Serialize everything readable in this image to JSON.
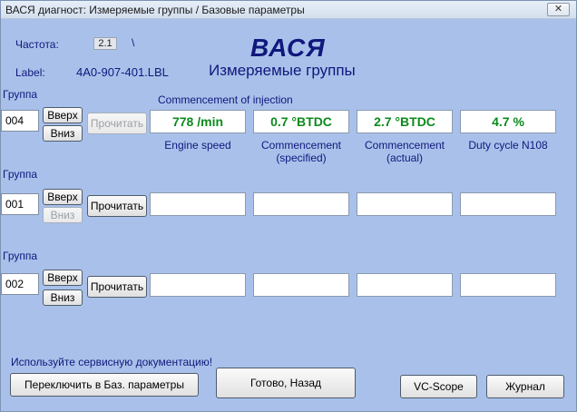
{
  "window": {
    "title": "ВАСЯ диагност: Измеряемые группы / Базовые параметры",
    "close_glyph": "✕"
  },
  "header": {
    "freq_label": "Частота:",
    "freq_value": "2.1",
    "freq_separator": "\\",
    "label_label": "Label:",
    "label_value": "4A0-907-401.LBL",
    "app_name": "ВАСЯ",
    "app_subtitle": "Измеряемые группы"
  },
  "groups": [
    {
      "label": "Группа",
      "number": "004",
      "up_label": "Вверх",
      "down_label": "Вниз",
      "read_label": "Прочитать",
      "header_text": "Commencement of injection",
      "values": [
        "778 /min",
        "0.7 °BTDC",
        "2.7 °BTDC",
        "4.7 %"
      ],
      "captions": [
        [
          "Engine speed"
        ],
        [
          "Commencement",
          "(specified)"
        ],
        [
          "Commencement",
          "(actual)"
        ],
        [
          "Duty cycle N108"
        ]
      ]
    },
    {
      "label": "Группа",
      "number": "001",
      "up_label": "Вверх",
      "down_label": "Вниз",
      "read_label": "Прочитать",
      "values": [
        "",
        "",
        "",
        ""
      ]
    },
    {
      "label": "Группа",
      "number": "002",
      "up_label": "Вверх",
      "down_label": "Вниз",
      "read_label": "Прочитать",
      "values": [
        "",
        "",
        "",
        ""
      ]
    }
  ],
  "footer": {
    "hint": "Используйте сервисную документацию!",
    "switch_label": "Переключить в Баз. параметры",
    "done_label": "Готово, Назад",
    "vcscope_label": "VC-Scope",
    "journal_label": "Журнал"
  },
  "colors": {
    "background": "#a9c1ea",
    "label_text": "#10177d",
    "value_text": "#0c8a1c"
  }
}
